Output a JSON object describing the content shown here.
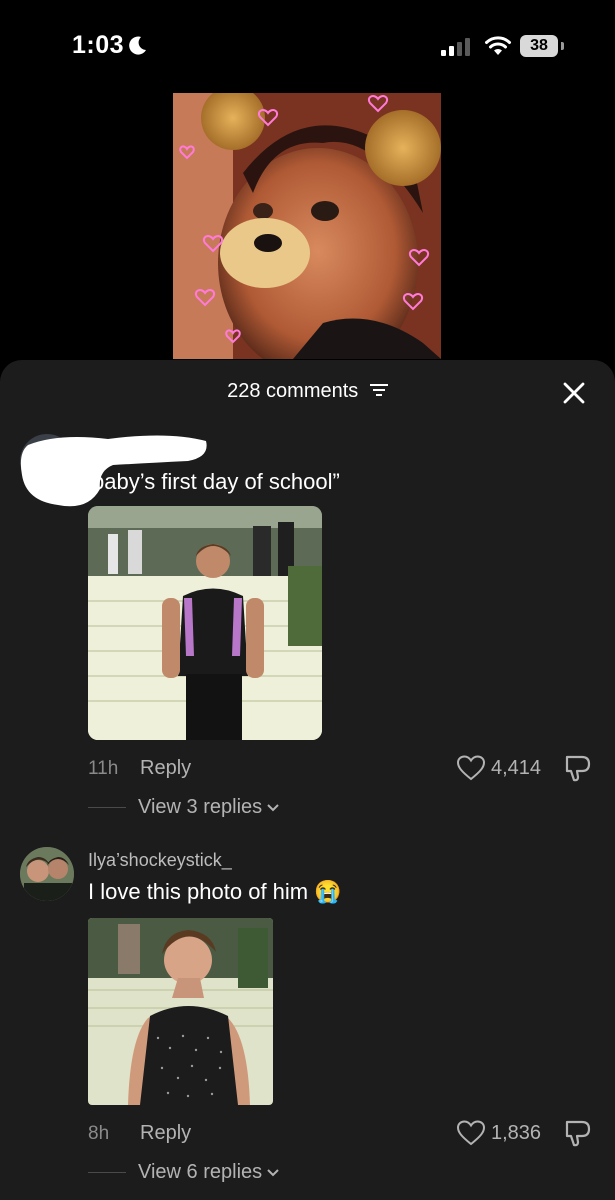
{
  "status_bar": {
    "time": "1:03",
    "battery": "38",
    "icons": [
      "moon-icon",
      "signal-icon",
      "wifi-icon",
      "battery-icon"
    ]
  },
  "video_preview": {
    "description_icon": "bear-filter-photo"
  },
  "comments_sheet": {
    "title": "228 comments",
    "icons": {
      "sort": "sort-icon",
      "close": "close-icon"
    },
    "comments": [
      {
        "username": "",
        "text": "baby’s first day of school”",
        "time": "11h",
        "reply_label": "Reply",
        "likes": "4,414",
        "view_replies": "View 3 replies"
      },
      {
        "username": "Ilya’shockeystick_",
        "text": "I love this photo of him 😭",
        "time": "8h",
        "reply_label": "Reply",
        "likes": "1,836",
        "view_replies": "View 6 replies"
      }
    ]
  },
  "colors": {
    "background": "#000000",
    "sheet": "#1c1c1c",
    "secondary_text": "#b3b3b3",
    "muted_text": "#8a8a8a"
  }
}
